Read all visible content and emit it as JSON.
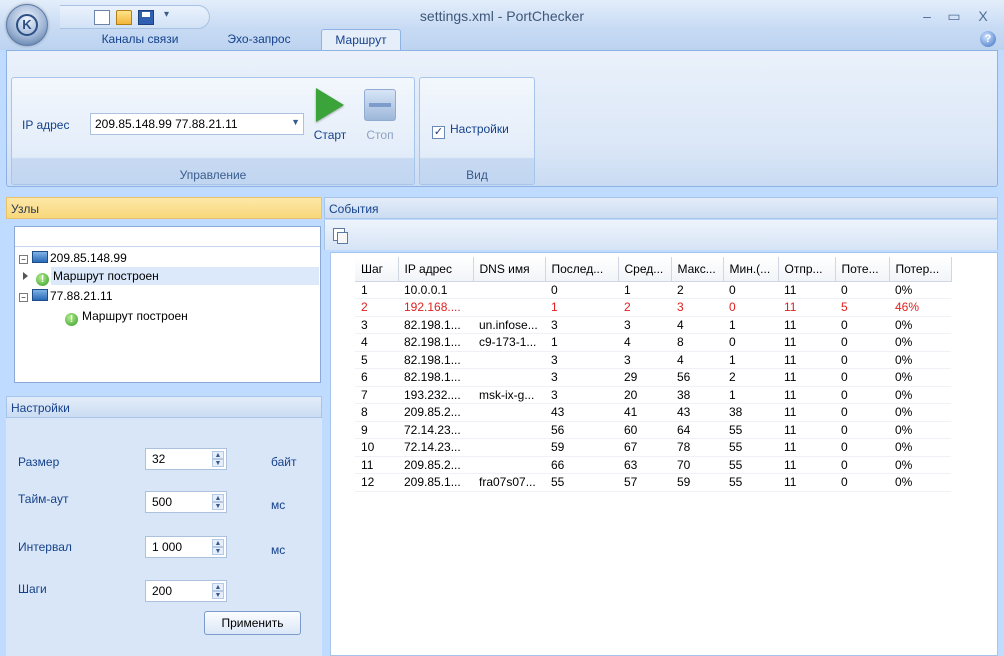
{
  "window": {
    "title": "settings.xml - PortChecker",
    "minimize": "–",
    "maximize": "▭",
    "close": "X"
  },
  "qat": {
    "more": "▾"
  },
  "tabs": [
    {
      "label": "Каналы связи"
    },
    {
      "label": "Эхо-запрос"
    },
    {
      "label": "Маршрут"
    }
  ],
  "ribbon": {
    "control": {
      "label": "Управление",
      "ip_label": "IP адрес",
      "ip_value": "209.85.148.99 77.88.21.11",
      "start_label": "Старт",
      "stop_label": "Стоп"
    },
    "view": {
      "label": "Вид",
      "settings_checkbox": "Настройки",
      "settings_checked": true
    }
  },
  "nodes": {
    "title": "Узлы",
    "items": [
      {
        "host": "209.85.148.99",
        "status": "Маршрут построен"
      },
      {
        "host": "77.88.21.11",
        "status": "Маршрут построен"
      }
    ],
    "expander": "−"
  },
  "settings": {
    "title": "Настройки",
    "fields": [
      {
        "label": "Размер",
        "value": "32",
        "unit": "байт"
      },
      {
        "label": "Тайм-аут",
        "value": "500",
        "unit": "мс"
      },
      {
        "label": "Интервал",
        "value": "1 000",
        "unit": "мс"
      },
      {
        "label": "Шаги",
        "value": "200",
        "unit": ""
      }
    ],
    "apply_label": "Применить"
  },
  "events": {
    "title": "События",
    "columns": [
      "Шаг",
      "IP адрес",
      "DNS имя",
      "Послед...",
      "Сред...",
      "Макс...",
      "Мин.(...",
      "Отпр...",
      "Поте...",
      "Потер..."
    ],
    "rows": [
      [
        "1",
        "10.0.0.1",
        "",
        "0",
        "1",
        "2",
        "0",
        "11",
        "0",
        "0%"
      ],
      [
        "2",
        "192.168....",
        "",
        "1",
        "2",
        "3",
        "0",
        "11",
        "5",
        "46%"
      ],
      [
        "3",
        "82.198.1...",
        "un.infose...",
        "3",
        "3",
        "4",
        "1",
        "11",
        "0",
        "0%"
      ],
      [
        "4",
        "82.198.1...",
        "c9-173-1...",
        "1",
        "4",
        "8",
        "0",
        "11",
        "0",
        "0%"
      ],
      [
        "5",
        "82.198.1...",
        "",
        "3",
        "3",
        "4",
        "1",
        "11",
        "0",
        "0%"
      ],
      [
        "6",
        "82.198.1...",
        "",
        "3",
        "29",
        "56",
        "2",
        "11",
        "0",
        "0%"
      ],
      [
        "7",
        "193.232....",
        "msk-ix-g...",
        "3",
        "20",
        "38",
        "1",
        "11",
        "0",
        "0%"
      ],
      [
        "8",
        "209.85.2...",
        "",
        "43",
        "41",
        "43",
        "38",
        "11",
        "0",
        "0%"
      ],
      [
        "9",
        "72.14.23...",
        "",
        "56",
        "60",
        "64",
        "55",
        "11",
        "0",
        "0%"
      ],
      [
        "10",
        "72.14.23...",
        "",
        "59",
        "67",
        "78",
        "55",
        "11",
        "0",
        "0%"
      ],
      [
        "11",
        "209.85.2...",
        "",
        "66",
        "63",
        "70",
        "55",
        "11",
        "0",
        "0%"
      ],
      [
        "12",
        "209.85.1...",
        "fra07s07...",
        "55",
        "57",
        "59",
        "55",
        "11",
        "0",
        "0%"
      ]
    ],
    "loss_row_color": "#e02020"
  },
  "colors": {
    "accent": "#15428b",
    "ribbon_bg": "#dbe7f7",
    "nodes_header": "#f8d77a",
    "ok_green": "#2f9b2b"
  }
}
